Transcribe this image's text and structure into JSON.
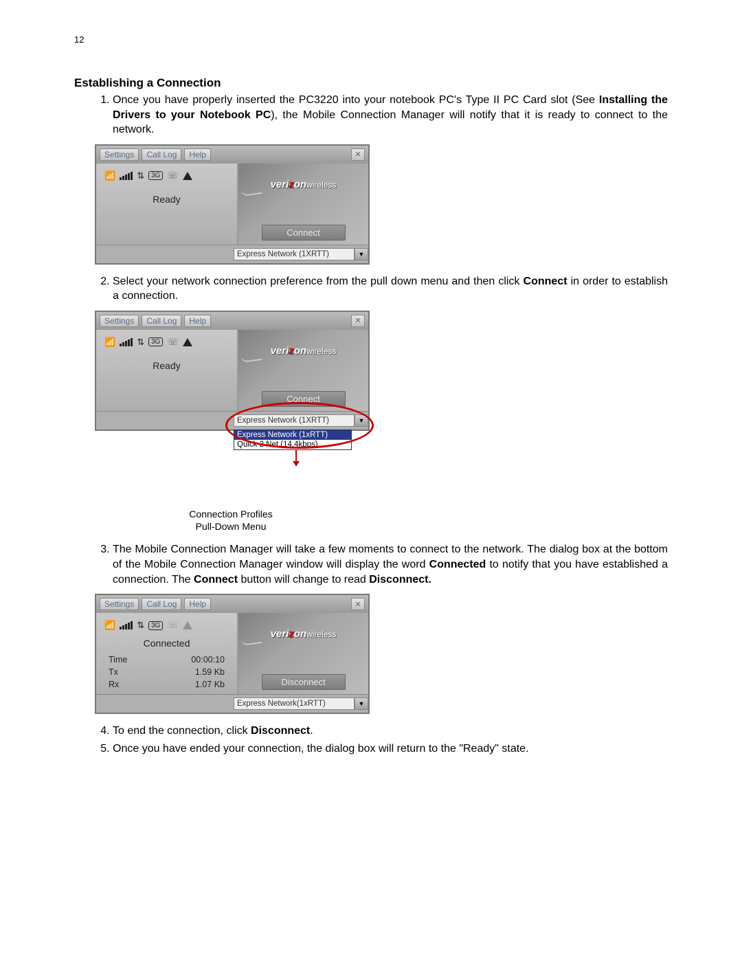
{
  "page_number": "12",
  "section_title": "Establishing a Connection",
  "steps": {
    "s1a": "Once you have properly inserted the PC3220 into your notebook PC's Type II PC Card slot (See ",
    "s1b": "Installing the Drivers to your Notebook PC",
    "s1c": "), the Mobile Connection Manager will notify that it is ready to connect to the network.",
    "s2a": "Select your network connection preference from the pull down menu and then click ",
    "s2b": "Connect",
    "s2c": " in order to establish a connection.",
    "s3a": "The Mobile Connection Manager will take a few moments to connect to the network. The dialog box at the bottom of the Mobile Connection Manager window will display the word ",
    "s3b": "Connected",
    "s3c": " to notify that you have established a connection. The ",
    "s3d": "Connect",
    "s3e": " button will change to read ",
    "s3f": "Disconnect.",
    "s4a": "To end the connection, click ",
    "s4b": "Disconnect",
    "s4c": ".",
    "s5": "Once you have ended your connection, the dialog box will return to the \"Ready\" state."
  },
  "app": {
    "menu": {
      "settings": "Settings",
      "calllog": "Call Log",
      "help": "Help"
    },
    "brand_a": "veri",
    "brand_b": "on",
    "brand_c": "wireless",
    "status_ready": "Ready",
    "status_connected": "Connected",
    "connect_label": "Connect",
    "disconnect_label": "Disconnect",
    "dropdown_selected": "Express Network (1XRTT)",
    "dropdown_selected3": "Express Network(1xRTT)",
    "dropdown_options": {
      "opt1": "Express Network (1xRTT)",
      "opt2": "Quick 2 Net (14.4kbps)"
    },
    "badge3g": "3G",
    "stats": {
      "time_label": "Time",
      "time_val": "00:00:10",
      "tx_label": "Tx",
      "tx_val": "1.59 Kb",
      "rx_label": "Rx",
      "rx_val": "1.07 Kb"
    }
  },
  "caption": {
    "line1": "Connection Profiles",
    "line2": "Pull-Down Menu"
  }
}
